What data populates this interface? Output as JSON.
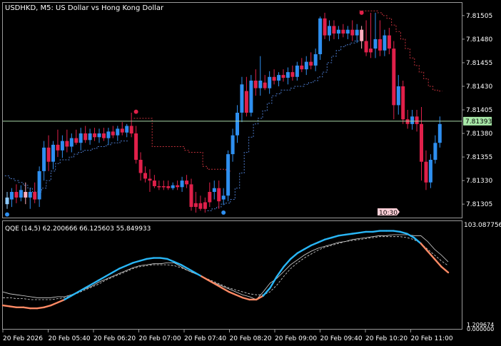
{
  "header": {
    "symbol_line": "USDHKD, M5:  US Dollar vs Hong Kong Dollar"
  },
  "main_chart": {
    "price_labels": [
      "7.81505",
      "7.81480",
      "7.81455",
      "7.81430",
      "7.81405",
      "7.81380",
      "7.81355",
      "7.81330",
      "7.81305"
    ],
    "current_price": "7.81393",
    "time_marker": "10:30"
  },
  "indicator": {
    "label": "QQE (14,5) 62.200666 66.125603 55.849933",
    "scale_top": "103.087756",
    "scale_mid": "1.209674",
    "scale_bottom": "0.000000"
  },
  "time_axis": {
    "labels": [
      "20 Feb 2026",
      "20 Feb 05:40",
      "20 Feb 06:20",
      "20 Feb 07:00",
      "20 Feb 07:40",
      "20 Feb 08:20",
      "20 Feb 09:00",
      "20 Feb 09:40",
      "20 Feb 10:20",
      "20 Feb 11:00"
    ]
  },
  "colors": {
    "bull": "#2e8ff0",
    "bull_light": "#8ecbff",
    "bear": "#e0204a",
    "bear_light": "#ffb0c0",
    "bull_stop": "#4a78c8",
    "bear_stop": "#c0303a",
    "grid_line": "#9a9a9a",
    "price_line": "#a8d8a8",
    "qqe_bull": "#29b6f6",
    "qqe_bear": "#ff8a65"
  },
  "chart_data": {
    "type": "candlestick",
    "price_min": 7.81293,
    "price_max": 7.81517,
    "candles": [
      [
        7.81305,
        7.81318,
        7.813,
        7.81312,
        "bull_light"
      ],
      [
        7.8131,
        7.81322,
        7.81302,
        7.81318,
        "bull"
      ],
      [
        7.81318,
        7.81326,
        7.81306,
        7.81312,
        "bear"
      ],
      [
        7.81312,
        7.81325,
        7.81308,
        7.8132,
        "bull"
      ],
      [
        7.81318,
        7.81328,
        7.81305,
        7.81312,
        "bear_light"
      ],
      [
        7.81312,
        7.81322,
        7.813,
        7.81318,
        "bull"
      ],
      [
        7.81318,
        7.81328,
        7.81306,
        7.8131,
        "bear"
      ],
      [
        7.8131,
        7.81345,
        7.81302,
        7.8134,
        "bull"
      ],
      [
        7.8134,
        7.81372,
        7.8133,
        7.81365,
        "bull"
      ],
      [
        7.81365,
        7.81378,
        7.8134,
        7.8135,
        "bear"
      ],
      [
        7.8135,
        7.81372,
        7.81342,
        7.81368,
        "bull"
      ],
      [
        7.81368,
        7.81384,
        7.81355,
        7.81362,
        "bear"
      ],
      [
        7.81362,
        7.81378,
        7.81354,
        7.81372,
        "bull"
      ],
      [
        7.81372,
        7.81384,
        7.8136,
        7.81366,
        "bear"
      ],
      [
        7.81366,
        7.8138,
        7.8136,
        7.81375,
        "bull"
      ],
      [
        7.81375,
        7.81384,
        7.81368,
        7.8137,
        "bear"
      ],
      [
        7.8137,
        7.81386,
        7.81362,
        7.8138,
        "bull"
      ],
      [
        7.8138,
        7.81388,
        7.8137,
        7.81373,
        "bear"
      ],
      [
        7.81373,
        7.81385,
        7.81368,
        7.8138,
        "bull"
      ],
      [
        7.8138,
        7.81386,
        7.81372,
        7.81376,
        "bear"
      ],
      [
        7.81376,
        7.81385,
        7.8137,
        7.8138,
        "bull"
      ],
      [
        7.8138,
        7.81386,
        7.81372,
        7.81375,
        "bear"
      ],
      [
        7.81375,
        7.81386,
        7.81368,
        7.81382,
        "bull"
      ],
      [
        7.81382,
        7.81388,
        7.81375,
        7.81378,
        "bear"
      ],
      [
        7.81378,
        7.81388,
        7.81372,
        7.81385,
        "bull"
      ],
      [
        7.81385,
        7.81392,
        7.81378,
        7.81381,
        "bear"
      ],
      [
        7.81381,
        7.8139,
        7.81376,
        7.81388,
        "bull"
      ],
      [
        7.81388,
        7.81402,
        7.81376,
        7.8138,
        "bear"
      ],
      [
        7.8138,
        7.81388,
        7.81348,
        7.81352,
        "bear"
      ],
      [
        7.81352,
        7.8136,
        7.8133,
        7.81338,
        "bear"
      ],
      [
        7.81338,
        7.81345,
        7.81328,
        7.81332,
        "bear"
      ],
      [
        7.81332,
        7.81342,
        7.81318,
        7.8133,
        "bear"
      ],
      [
        7.8133,
        7.81336,
        7.81322,
        7.81324,
        "bear"
      ],
      [
        7.81324,
        7.8133,
        7.8132,
        7.81323,
        "bear"
      ],
      [
        7.81323,
        7.8133,
        7.8132,
        7.81324,
        "bear"
      ],
      [
        7.81324,
        7.8133,
        7.8132,
        7.81322,
        "bear"
      ],
      [
        7.81322,
        7.81328,
        7.8132,
        7.81325,
        "bull"
      ],
      [
        7.81325,
        7.8133,
        7.8132,
        7.81323,
        "bear"
      ],
      [
        7.81323,
        7.81334,
        7.81318,
        7.8133,
        "bull"
      ],
      [
        7.8133,
        7.81336,
        7.81322,
        7.81326,
        "bear"
      ],
      [
        7.81326,
        7.81332,
        7.81298,
        7.81302,
        "bear"
      ],
      [
        7.81302,
        7.81318,
        7.81296,
        7.81306,
        "bear"
      ],
      [
        7.81306,
        7.81314,
        7.81298,
        7.813,
        "bear"
      ],
      [
        7.813,
        7.81312,
        7.81296,
        7.81307,
        "bear"
      ],
      [
        7.81307,
        7.81328,
        7.81302,
        7.81318,
        "bear"
      ],
      [
        7.81318,
        7.8133,
        7.8131,
        7.81322,
        "bull"
      ],
      [
        7.81322,
        7.8133,
        7.813,
        7.81308,
        "bear"
      ],
      [
        7.8131,
        7.81322,
        7.81304,
        7.81314,
        "bull"
      ],
      [
        7.81314,
        7.81362,
        7.81308,
        7.81358,
        "bull"
      ],
      [
        7.81358,
        7.81385,
        7.8135,
        7.81378,
        "bull"
      ],
      [
        7.81378,
        7.8141,
        7.8137,
        7.81402,
        "bull"
      ],
      [
        7.81402,
        7.8144,
        7.81392,
        7.81432,
        "bull"
      ],
      [
        7.81425,
        7.8144,
        7.81398,
        7.81402,
        "bear"
      ],
      [
        7.81402,
        7.81442,
        7.81398,
        7.81436,
        "bull"
      ],
      [
        7.81436,
        7.81448,
        7.8142,
        7.81428,
        "bear"
      ],
      [
        7.81428,
        7.81462,
        7.8142,
        7.81436,
        "bull"
      ],
      [
        7.81434,
        7.81442,
        7.81426,
        7.81428,
        "bear"
      ],
      [
        7.81428,
        7.81446,
        7.81422,
        7.8144,
        "bull"
      ],
      [
        7.8144,
        7.81448,
        7.81432,
        7.81436,
        "bear"
      ],
      [
        7.81436,
        7.81445,
        7.8143,
        7.81442,
        "bull"
      ],
      [
        7.81442,
        7.81448,
        7.81435,
        7.81439,
        "bear"
      ],
      [
        7.81439,
        7.8145,
        7.81432,
        7.81445,
        "bull"
      ],
      [
        7.81445,
        7.81452,
        7.81436,
        7.8144,
        "bear"
      ],
      [
        7.8144,
        7.81456,
        7.81436,
        7.81452,
        "bull"
      ],
      [
        7.81452,
        7.8146,
        7.81445,
        7.81448,
        "bear"
      ],
      [
        7.81448,
        7.81462,
        7.81442,
        7.81456,
        "bull"
      ],
      [
        7.81456,
        7.81466,
        7.81448,
        7.81452,
        "bear"
      ],
      [
        7.81452,
        7.8147,
        7.81446,
        7.81464,
        "bull"
      ],
      [
        7.81464,
        7.81504,
        7.81458,
        7.81502,
        "bull"
      ],
      [
        7.81502,
        7.81508,
        7.8148,
        7.81484,
        "bear"
      ],
      [
        7.81484,
        7.815,
        7.81478,
        7.81494,
        "bull"
      ],
      [
        7.81494,
        7.815,
        7.8148,
        7.81486,
        "bear"
      ],
      [
        7.81486,
        7.81494,
        7.8148,
        7.8149,
        "bull"
      ],
      [
        7.8149,
        7.81496,
        7.81482,
        7.81486,
        "bear"
      ],
      [
        7.81486,
        7.81494,
        7.8148,
        7.8149,
        "bull"
      ],
      [
        7.8149,
        7.815,
        7.81478,
        7.81484,
        "bear"
      ],
      [
        7.81484,
        7.81496,
        7.81476,
        7.8149,
        "bull"
      ],
      [
        7.8149,
        7.81494,
        7.8147,
        7.81478,
        "bear_light"
      ],
      [
        7.81478,
        7.815,
        7.81462,
        7.81466,
        "bear"
      ],
      [
        7.81466,
        7.81508,
        7.8146,
        7.8147,
        "bear"
      ],
      [
        7.8147,
        7.81508,
        7.8146,
        7.8148,
        "bull"
      ],
      [
        7.8148,
        7.815,
        7.81462,
        7.81468,
        "bear"
      ],
      [
        7.81468,
        7.8149,
        7.81462,
        7.81484,
        "bull"
      ],
      [
        7.81484,
        7.81492,
        7.81464,
        7.8147,
        "bear"
      ],
      [
        7.8147,
        7.81478,
        7.81395,
        7.8141,
        "bear"
      ],
      [
        7.8141,
        7.81442,
        7.814,
        7.8143,
        "bull"
      ],
      [
        7.8143,
        7.81436,
        7.8139,
        7.81395,
        "bear"
      ],
      [
        7.81395,
        7.81405,
        7.81385,
        7.8139,
        "bear"
      ],
      [
        7.8139,
        7.81405,
        7.81384,
        7.81398,
        "bull"
      ],
      [
        7.81398,
        7.81405,
        7.81382,
        7.8139,
        "bear"
      ],
      [
        7.8139,
        7.81408,
        7.8133,
        7.8135,
        "bear"
      ],
      [
        7.8135,
        7.81362,
        7.8132,
        7.81328,
        "bear"
      ],
      [
        7.81328,
        7.81358,
        7.81322,
        7.81352,
        "bull"
      ],
      [
        7.81352,
        7.81378,
        7.81348,
        7.8137,
        "bull"
      ],
      [
        7.8137,
        7.81398,
        7.81365,
        7.8139,
        "bull"
      ]
    ],
    "up_stop_start": 0,
    "up_stop": [
      7.81335,
      7.81332,
      7.8133,
      7.81328,
      7.81325,
      7.81322,
      7.81318,
      7.81318,
      7.81322,
      7.8133,
      7.8134,
      7.81348,
      7.81352,
      7.81352,
      7.81355,
      7.81358,
      7.8136,
      7.81362,
      7.81362,
      7.81364,
      7.81366,
      7.81366,
      7.81368,
      7.8137,
      7.8137,
      7.81372,
      7.81372
    ],
    "down_stop_start": 28,
    "down_stop": [
      7.81396,
      7.81396,
      7.81396,
      7.81396,
      7.81366,
      7.81366,
      7.81366,
      7.81366,
      7.81366,
      7.81366,
      7.81366,
      7.81362,
      7.8136,
      7.8136,
      7.8136,
      7.81345,
      7.81342,
      7.81342,
      7.81342,
      7.81342,
      7.8134
    ],
    "up_stop2_start": 44,
    "up_stop2": [
      7.81298,
      7.813,
      7.81302,
      7.81305,
      7.81306,
      7.8131,
      7.81322,
      7.81338,
      7.8136,
      7.81376,
      7.8139,
      7.81396,
      7.81404,
      7.81412,
      7.8142,
      7.81422,
      7.81426,
      7.81426,
      7.81428,
      7.8143,
      7.8143,
      7.81432,
      7.81434,
      7.81436,
      7.8144,
      7.81445,
      7.81455,
      7.81462,
      7.81468,
      7.81472,
      7.81474,
      7.81476,
      7.81478
    ],
    "down_stop2_start": 77,
    "down_stop2": [
      7.8151,
      7.8151,
      7.8151,
      7.8151,
      7.81508,
      7.81505,
      7.81502,
      7.81495,
      7.81488,
      7.8148,
      7.8147,
      7.8146,
      7.81452,
      7.81445,
      7.81438,
      7.8143,
      7.81426,
      7.81425
    ],
    "dot_markers": [
      {
        "i": 0,
        "p": 7.81294,
        "c": "bull"
      },
      {
        "i": 28,
        "p": 7.81403,
        "c": "bear"
      },
      {
        "i": 47,
        "p": 7.81296,
        "c": "bull"
      },
      {
        "i": 77,
        "p": 7.81508,
        "c": "bear"
      }
    ],
    "qqe": {
      "min": 0,
      "max": 103.087756,
      "rsi": [
        22,
        21,
        20,
        20,
        19,
        19,
        20,
        22,
        25,
        28,
        32,
        36,
        40,
        44,
        48,
        52,
        56,
        60,
        63,
        66,
        68,
        70,
        71,
        71,
        70,
        67,
        64,
        60,
        56,
        52,
        48,
        44,
        40,
        36,
        33,
        30,
        28,
        28,
        32,
        40,
        52,
        62,
        70,
        76,
        80,
        84,
        87,
        90,
        92,
        94,
        95,
        96,
        97,
        98,
        98,
        99,
        99,
        99,
        98,
        96,
        92,
        86,
        78,
        70,
        62,
        56
      ],
      "line_a": [
        30,
        30,
        29,
        29,
        28,
        28,
        28,
        28,
        29,
        30,
        32,
        35,
        38,
        41,
        44,
        48,
        51,
        54,
        57,
        60,
        62,
        63,
        64,
        64,
        64,
        63,
        61,
        58,
        55,
        52,
        49,
        46,
        43,
        40,
        38,
        36,
        34,
        33,
        33,
        36,
        43,
        52,
        60,
        66,
        71,
        75,
        79,
        82,
        84,
        86,
        88,
        89,
        90,
        91,
        92,
        93,
        93,
        93,
        93,
        92,
        90,
        86,
        80,
        74,
        68,
        63
      ],
      "line_b": [
        36,
        34,
        33,
        32,
        31,
        30,
        30,
        30,
        31,
        31,
        33,
        36,
        39,
        42,
        46,
        49,
        52,
        55,
        58,
        61,
        63,
        64,
        65,
        65,
        66,
        66,
        62,
        58,
        55,
        52,
        48,
        45,
        42,
        39,
        36,
        33,
        31,
        28,
        36,
        45,
        50,
        57,
        64,
        69,
        74,
        78,
        81,
        83,
        85,
        87,
        88,
        90,
        91,
        92,
        93,
        94,
        94,
        95,
        95,
        95,
        94,
        94,
        88,
        80,
        74,
        67
      ]
    }
  }
}
